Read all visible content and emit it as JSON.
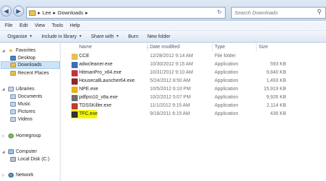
{
  "address": {
    "path": [
      "Lee",
      "Downloads"
    ],
    "search_placeholder": "Search Downloads"
  },
  "menu": [
    "File",
    "Edit",
    "View",
    "Tools",
    "Help"
  ],
  "commands": [
    {
      "label": "Organize",
      "dropdown": true
    },
    {
      "label": "Include in library",
      "dropdown": true
    },
    {
      "label": "Share with",
      "dropdown": true
    },
    {
      "label": "Burn",
      "dropdown": false
    },
    {
      "label": "New folder",
      "dropdown": false
    }
  ],
  "nav": {
    "favorites": "Favorites",
    "desktop": "Desktop",
    "downloads": "Downloads",
    "recent": "Recent Places",
    "libraries": "Libraries",
    "documents": "Documents",
    "music": "Music",
    "pictures": "Pictures",
    "videos": "Videos",
    "homegroup": "Homegroup",
    "computer": "Computer",
    "local_disk": "Local Disk (C:)",
    "network": "Network"
  },
  "columns": {
    "name": "Name",
    "date": "Date modified",
    "type": "Type",
    "size": "Size"
  },
  "files": [
    {
      "name": "CCE",
      "date": "12/28/2012 9:14 AM",
      "type": "File folder",
      "size": "",
      "color": "#e5bf5a"
    },
    {
      "name": "adwcleaner.exe",
      "date": "10/30/2012 9:15 AM",
      "type": "Application",
      "size": "593 KB",
      "color": "#3b6fb6"
    },
    {
      "name": "HitmanPro_x64.exe",
      "date": "10/31/2012 9:10 AM",
      "type": "Application",
      "size": "9,840 KB",
      "color": "#c7323a"
    },
    {
      "name": "HousecallLauncher64.exe",
      "date": "5/24/2012 8:50 AM",
      "type": "Application",
      "size": "1,493 KB",
      "color": "#8a2a2a"
    },
    {
      "name": "NPE.exe",
      "date": "10/5/2012 6:10 PM",
      "type": "Application",
      "size": "15,919 KB",
      "color": "#e6b21d"
    },
    {
      "name": "pdfpro10_v8a.exe",
      "date": "10/2/2012 5:07 PM",
      "type": "Application",
      "size": "9,926 KB",
      "color": "#6e6e6e"
    },
    {
      "name": "TDSSKiller.exe",
      "date": "11/1/2012 9:15 AM",
      "type": "Application",
      "size": "2,114 KB",
      "color": "#c43a2e"
    },
    {
      "name": "TFC.exe",
      "date": "9/18/2011 6:15 AM",
      "type": "Application",
      "size": "436 KB",
      "color": "#333333"
    }
  ],
  "highlight_color": "#f3f500"
}
